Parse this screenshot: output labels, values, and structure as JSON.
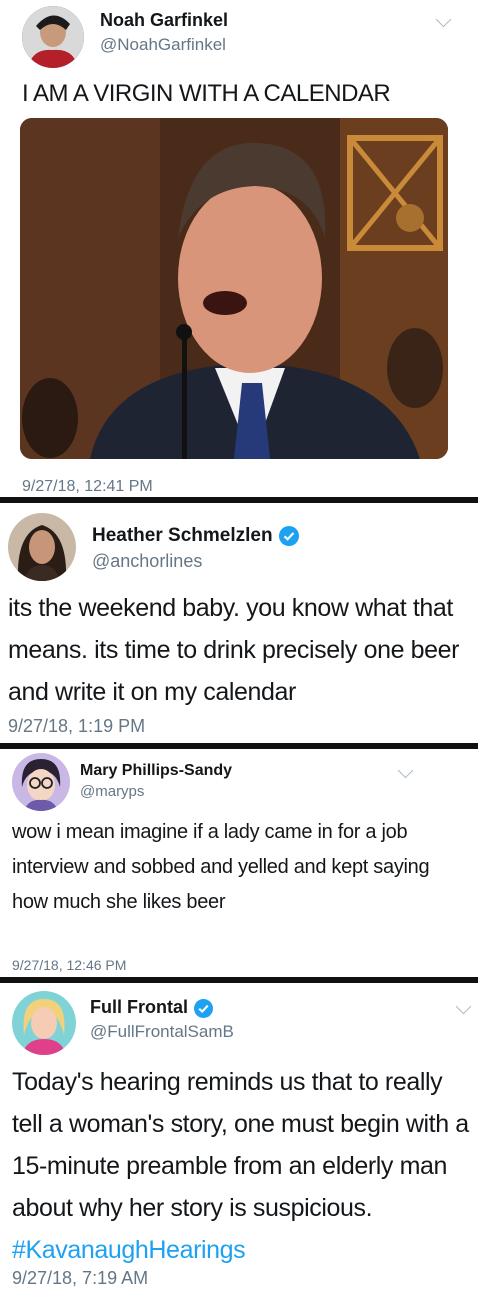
{
  "tweets": [
    {
      "name": "Noah Garfinkel",
      "handle": "@NoahGarfinkel",
      "text": "I AM A VIRGIN WITH A CALENDAR",
      "time": "9/27/18, 12:41 PM"
    },
    {
      "name": "Heather Schmelzlen",
      "handle": "@anchorlines",
      "text": "its the weekend baby. you know what that means. its time to drink precisely one beer and write it on my calendar",
      "time": "9/27/18, 1:19 PM"
    },
    {
      "name": "Mary Phillips-Sandy",
      "handle": "@maryps",
      "text": "wow i mean imagine if a lady came in for a job interview and sobbed and yelled and kept saying how much she likes beer",
      "time": "9/27/18, 12:46 PM"
    },
    {
      "name": "Full Frontal",
      "handle": "@FullFrontalSamB",
      "text": "Today's hearing reminds us that to really tell a woman's story, one must begin with a 15-minute preamble from an elderly man about why her story is suspicious.",
      "hashtag": "#KavanaughHearings",
      "time": "9/27/18, 7:19 AM"
    }
  ]
}
